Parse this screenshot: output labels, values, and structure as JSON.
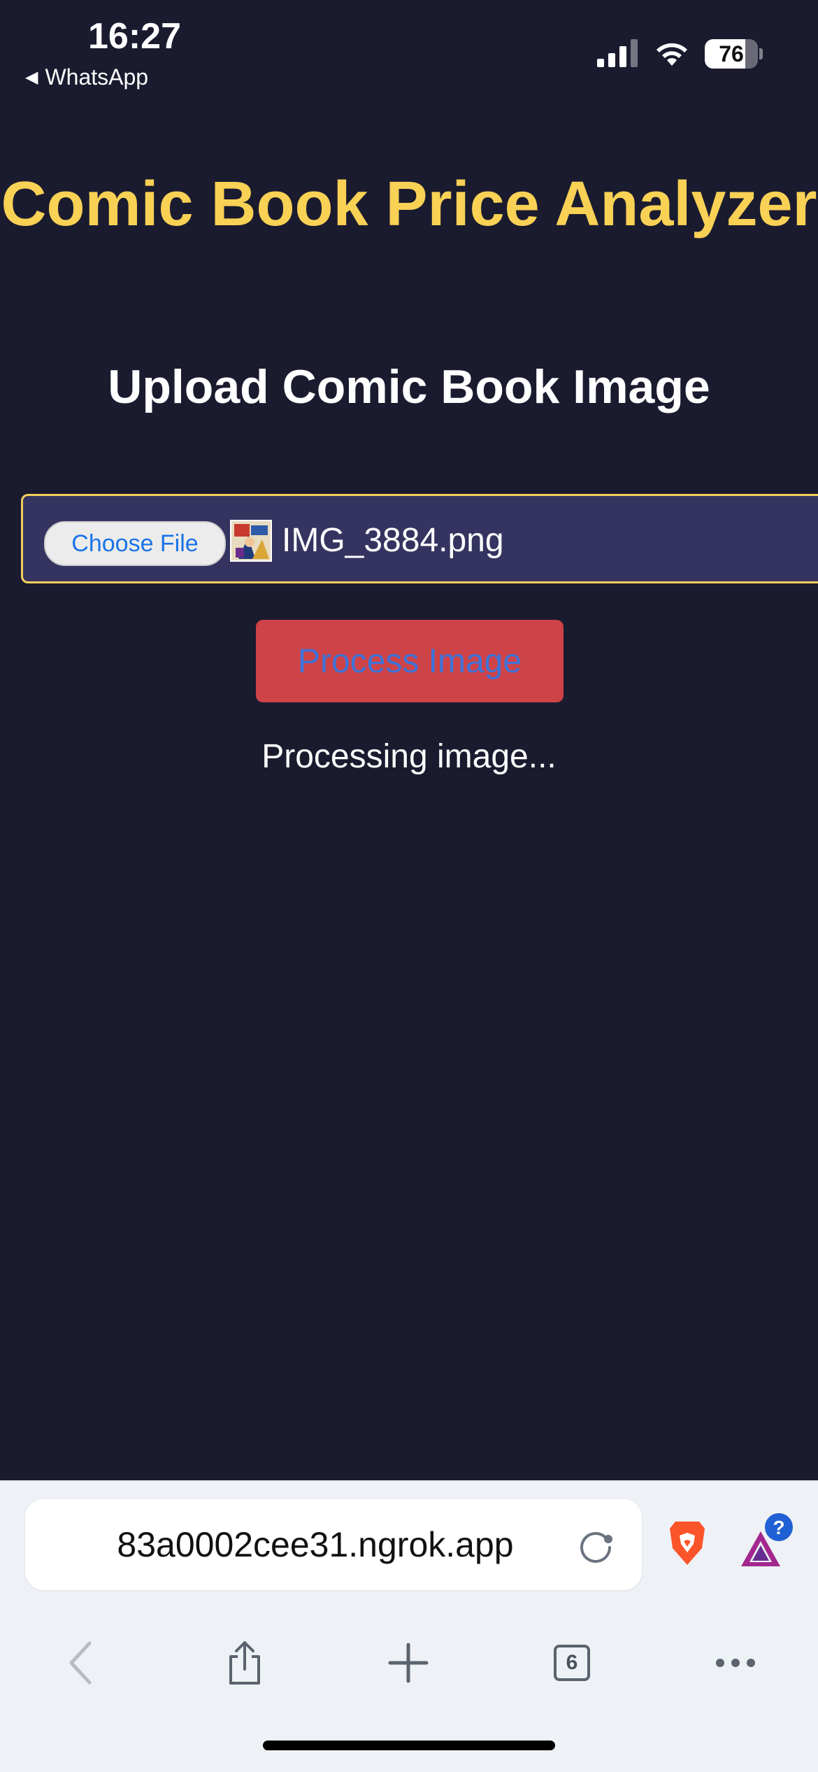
{
  "status_bar": {
    "time": "16:27",
    "back_app": "WhatsApp",
    "battery_level": "76"
  },
  "page": {
    "title": "Comic Book Price Analyzer",
    "subtitle": "Upload Comic Book Image",
    "file_input": {
      "button_label": "Choose File",
      "file_name": "IMG_3884.png"
    },
    "process_button": "Process Image",
    "status_message": "Processing image..."
  },
  "browser": {
    "url": "83a0002cee31.ngrok.app",
    "tab_count": "6",
    "rewards_badge": "?",
    "icons": [
      "reload-icon",
      "brave-lion-icon",
      "brave-rewards-icon",
      "back-icon",
      "share-icon",
      "new-tab-icon",
      "tabs-icon",
      "more-icon"
    ]
  },
  "colors": {
    "background": "#1b1b2f",
    "title": "#f8d155",
    "file_box": "#35335f",
    "file_box_border": "#f2cf5c",
    "process_button": "#cd4347",
    "process_button_text": "#3f73d9"
  }
}
